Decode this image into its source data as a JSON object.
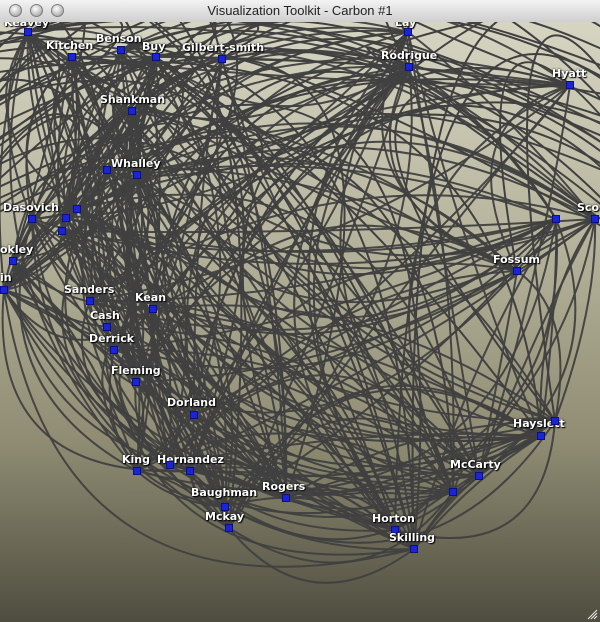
{
  "window": {
    "title": "Visualization Toolkit - Carbon #1"
  },
  "nodes": [
    {
      "label": "Keavey"
    },
    {
      "label": "Kitchen"
    },
    {
      "label": "Benson"
    },
    {
      "label": "Buy"
    },
    {
      "label": "Gilbert-smith"
    },
    {
      "label": "Lay"
    },
    {
      "label": "Rodrigue"
    },
    {
      "label": "Hyatt"
    },
    {
      "label": "Shankman"
    },
    {
      "label": "Whalley"
    },
    {
      "label": "Dasovich"
    },
    {
      "label": "Sco"
    },
    {
      "label": "okley"
    },
    {
      "label": "Fossum"
    },
    {
      "label": "in"
    },
    {
      "label": "Sanders"
    },
    {
      "label": "Kean"
    },
    {
      "label": "Cash"
    },
    {
      "label": "Derrick"
    },
    {
      "label": "Fleming"
    },
    {
      "label": "Dorland"
    },
    {
      "label": "Hayslett"
    },
    {
      "label": "King"
    },
    {
      "label": "Hernandez"
    },
    {
      "label": "McCarty"
    },
    {
      "label": "Baughman"
    },
    {
      "label": "Rogers"
    },
    {
      "label": "Mckay"
    },
    {
      "label": "Horton"
    },
    {
      "label": "Skilling"
    }
  ],
  "colors": {
    "node": "#1a24d9",
    "edge": "#404040",
    "label": "#ffffff"
  }
}
